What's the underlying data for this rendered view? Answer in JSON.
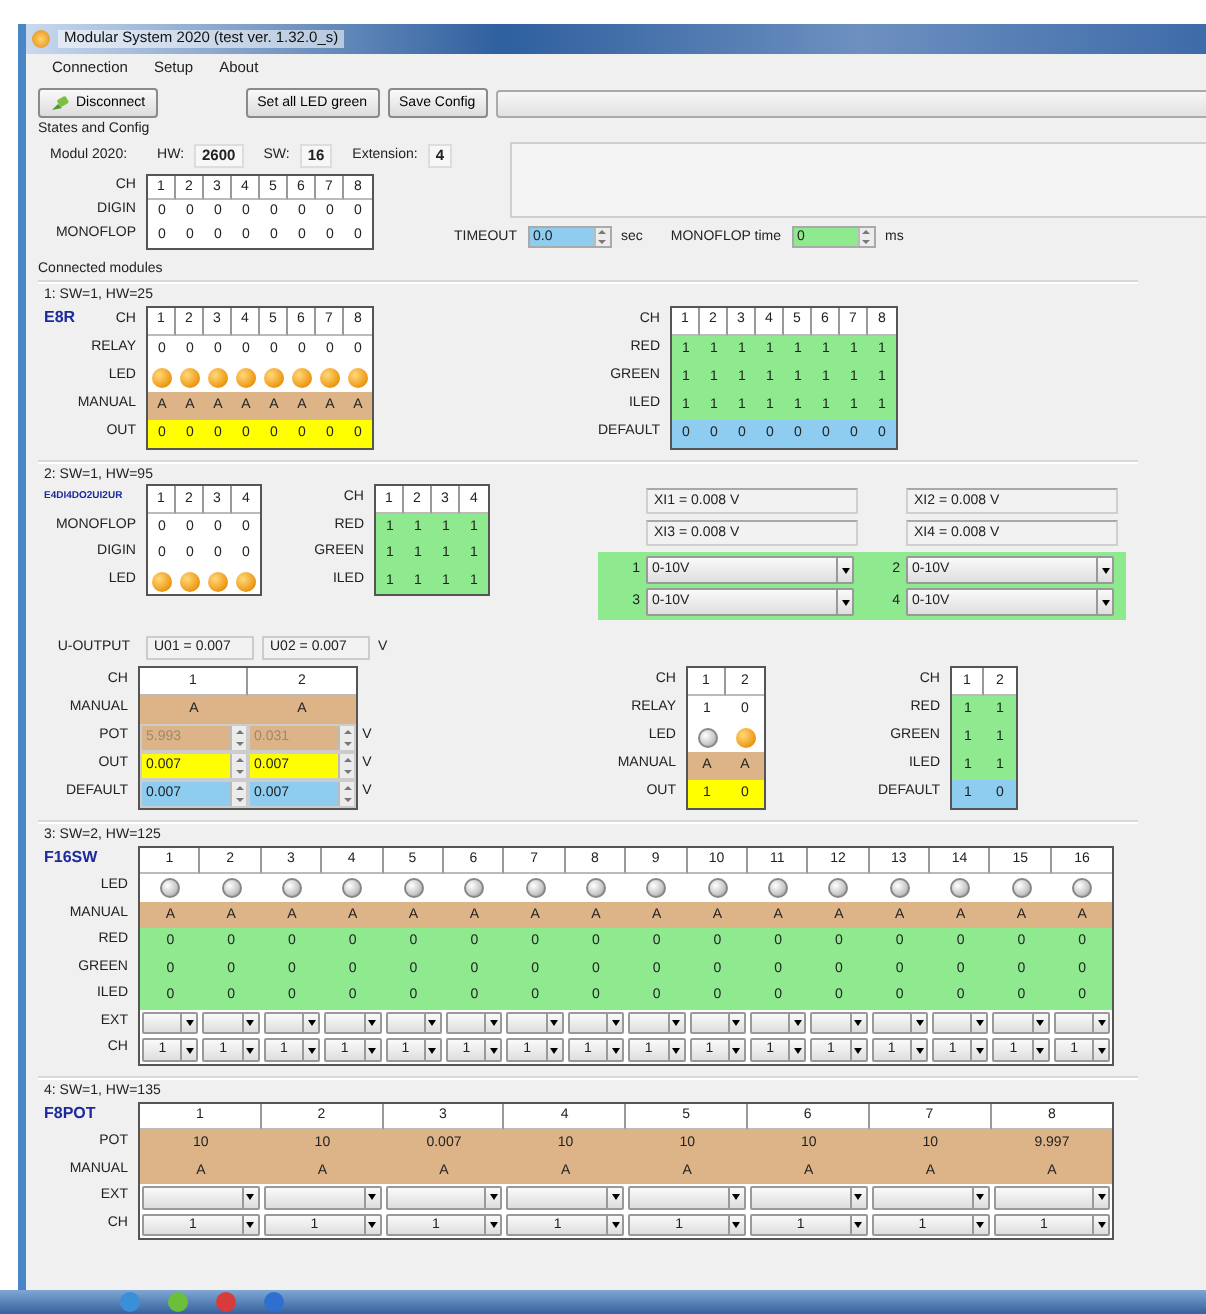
{
  "window": {
    "title": "Modular System 2020 (test ver. 1.32.0_s)"
  },
  "menu": [
    "Connection",
    "Setup",
    "About"
  ],
  "toolbar": {
    "buttons": [
      {
        "label": "Disconnect",
        "kind": "icon"
      },
      {
        "label": "Set all LED green",
        "kind": "plain"
      },
      {
        "label": "Save Config",
        "kind": "plain"
      }
    ]
  },
  "states": {
    "title": "States and Config",
    "module_label": "Modul 2020:",
    "fields": [
      {
        "label": "HW:",
        "value": "2600"
      },
      {
        "label": "SW:",
        "value": "16"
      },
      {
        "label": "Extension:",
        "value": "4"
      }
    ],
    "grid": {
      "corner": "CH",
      "header": [
        "1",
        "2",
        "3",
        "4",
        "5",
        "6",
        "7",
        "8"
      ],
      "rows": [
        {
          "label": "DIGIN",
          "kind": "text",
          "cells": [
            "0",
            "0",
            "0",
            "0",
            "0",
            "0",
            "0",
            "0"
          ]
        },
        {
          "label": "MONOFLOP",
          "kind": "text",
          "cells": [
            "0",
            "0",
            "0",
            "0",
            "0",
            "0",
            "0",
            "0"
          ]
        }
      ]
    },
    "timeout": {
      "label": "TIMEOUT",
      "value": "0.0",
      "unit": "sec"
    },
    "monoflop_time": {
      "label": "MONOFLOP time",
      "value": "0",
      "unit": "ms"
    }
  },
  "connected_modules": {
    "title": "Connected modules",
    "modules": [
      {
        "heading": "1: SW=1, HW=25",
        "name": "E8R",
        "lines": [
          [
            {
              "kind": "grid",
              "corner": "CH",
              "header": [
                "1",
                "2",
                "3",
                "4",
                "5",
                "6",
                "7",
                "8"
              ],
              "rows": [
                {
                  "label": "RELAY",
                  "kind": "text",
                  "cells": [
                    "0",
                    "0",
                    "0",
                    "0",
                    "0",
                    "0",
                    "0",
                    "0"
                  ]
                },
                {
                  "label": "LED",
                  "kind": "led",
                  "cells": [
                    {
                      "on": true
                    },
                    {
                      "on": true
                    },
                    {
                      "on": true
                    },
                    {
                      "on": true
                    },
                    {
                      "on": true
                    },
                    {
                      "on": true
                    },
                    {
                      "on": true
                    },
                    {
                      "on": true
                    }
                  ]
                },
                {
                  "label": "MANUAL",
                  "kind": "text",
                  "color": "#ddb487",
                  "cells": [
                    "A",
                    "A",
                    "A",
                    "A",
                    "A",
                    "A",
                    "A",
                    "A"
                  ]
                },
                {
                  "label": "OUT",
                  "kind": "text",
                  "color": "#ffff00",
                  "cells": [
                    "0",
                    "0",
                    "0",
                    "0",
                    "0",
                    "0",
                    "0",
                    "0"
                  ]
                }
              ]
            },
            {
              "kind": "grid",
              "corner": "CH",
              "header": [
                "1",
                "2",
                "3",
                "4",
                "5",
                "6",
                "7",
                "8"
              ],
              "rows": [
                {
                  "label": "RED",
                  "kind": "text",
                  "color": "#8fe98f",
                  "cells": [
                    "1",
                    "1",
                    "1",
                    "1",
                    "1",
                    "1",
                    "1",
                    "1"
                  ]
                },
                {
                  "label": "GREEN",
                  "kind": "text",
                  "color": "#8fe98f",
                  "cells": [
                    "1",
                    "1",
                    "1",
                    "1",
                    "1",
                    "1",
                    "1",
                    "1"
                  ]
                },
                {
                  "label": "ILED",
                  "kind": "text",
                  "color": "#8fe98f",
                  "cells": [
                    "1",
                    "1",
                    "1",
                    "1",
                    "1",
                    "1",
                    "1",
                    "1"
                  ]
                },
                {
                  "label": "DEFAULT",
                  "kind": "text",
                  "color": "#8fcdf0",
                  "cells": [
                    "0",
                    "0",
                    "0",
                    "0",
                    "0",
                    "0",
                    "0",
                    "0"
                  ]
                }
              ]
            }
          ]
        ]
      },
      {
        "heading": "2: SW=1, HW=95",
        "name": "E4DI4DO2UI2UR",
        "lines": [
          [
            {
              "kind": "grid",
              "header": [
                "1",
                "2",
                "3",
                "4"
              ],
              "rows": [
                {
                  "label": "MONOFLOP",
                  "kind": "text",
                  "cells": [
                    "0",
                    "0",
                    "0",
                    "0"
                  ]
                },
                {
                  "label": "DIGIN",
                  "kind": "text",
                  "cells": [
                    "0",
                    "0",
                    "0",
                    "0"
                  ]
                },
                {
                  "label": "LED",
                  "kind": "led",
                  "cells": [
                    {
                      "on": true
                    },
                    {
                      "on": true
                    },
                    {
                      "on": true
                    },
                    {
                      "on": true
                    }
                  ]
                }
              ]
            },
            {
              "kind": "grid",
              "corner": "CH",
              "header": [
                "1",
                "2",
                "3",
                "4"
              ],
              "rows": [
                {
                  "label": "RED",
                  "kind": "text",
                  "color": "#8fe98f",
                  "cells": [
                    "1",
                    "1",
                    "1",
                    "1"
                  ]
                },
                {
                  "label": "GREEN",
                  "kind": "text",
                  "color": "#8fe98f",
                  "cells": [
                    "1",
                    "1",
                    "1",
                    "1"
                  ]
                },
                {
                  "label": "ILED",
                  "kind": "text",
                  "color": "#8fe98f",
                  "cells": [
                    "1",
                    "1",
                    "1",
                    "1"
                  ]
                }
              ]
            },
            {
              "kind": "inputs",
              "readouts": [
                "XI1 = 0.008 V",
                "XI2 = 0.008 V",
                "XI3 = 0.008 V",
                "XI4 = 0.008 V"
              ],
              "selects": [
                {
                  "channel": "1",
                  "value": "0-10V"
                },
                {
                  "channel": "2",
                  "value": "0-10V"
                },
                {
                  "channel": "3",
                  "value": "0-10V"
                },
                {
                  "channel": "4",
                  "value": "0-10V"
                }
              ]
            }
          ],
          [
            {
              "kind": "uoutput",
              "label": "U-OUTPUT",
              "values": [
                "U01 = 0.007",
                "U02 = 0.007"
              ],
              "unit": "V"
            }
          ],
          [
            {
              "kind": "grid",
              "corner": "CH",
              "header": [
                "1",
                "2"
              ],
              "rows": [
                {
                  "label": "MANUAL",
                  "kind": "text",
                  "color": "#ddb487",
                  "cells": [
                    "A",
                    "A"
                  ]
                },
                {
                  "label": "POT",
                  "kind": "spin",
                  "color": "#ddb487",
                  "disabled": true,
                  "unit": "V",
                  "cells": [
                    {
                      "value": "5.993"
                    },
                    {
                      "value": "0.031"
                    }
                  ]
                },
                {
                  "label": "OUT",
                  "kind": "spin",
                  "color": "#ffff00",
                  "disabled": false,
                  "unit": "V",
                  "cells": [
                    {
                      "value": "0.007"
                    },
                    {
                      "value": "0.007"
                    }
                  ]
                },
                {
                  "label": "DEFAULT",
                  "kind": "spin",
                  "color": "#8fcdf0",
                  "disabled": false,
                  "unit": "V",
                  "cells": [
                    {
                      "value": "0.007"
                    },
                    {
                      "value": "0.007"
                    }
                  ]
                }
              ]
            },
            {
              "kind": "grid",
              "corner": "CH",
              "header": [
                "1",
                "2"
              ],
              "rows": [
                {
                  "label": "RELAY",
                  "kind": "text",
                  "cells": [
                    "1",
                    "0"
                  ]
                },
                {
                  "label": "LED",
                  "kind": "led",
                  "cells": [
                    {
                      "on": false
                    },
                    {
                      "on": true
                    }
                  ]
                },
                {
                  "label": "MANUAL",
                  "kind": "text",
                  "color": "#ddb487",
                  "cells": [
                    "A",
                    "A"
                  ]
                },
                {
                  "label": "OUT",
                  "kind": "text",
                  "color": "#ffff00",
                  "cells": [
                    "1",
                    "0"
                  ]
                }
              ]
            },
            {
              "kind": "grid",
              "corner": "CH",
              "header": [
                "1",
                "2"
              ],
              "rows": [
                {
                  "label": "RED",
                  "kind": "text",
                  "color": "#8fe98f",
                  "cells": [
                    "1",
                    "1"
                  ]
                },
                {
                  "label": "GREEN",
                  "kind": "text",
                  "color": "#8fe98f",
                  "cells": [
                    "1",
                    "1"
                  ]
                },
                {
                  "label": "ILED",
                  "kind": "text",
                  "color": "#8fe98f",
                  "cells": [
                    "1",
                    "1"
                  ]
                },
                {
                  "label": "DEFAULT",
                  "kind": "text",
                  "color": "#8fcdf0",
                  "cells": [
                    "1",
                    "0"
                  ]
                }
              ]
            }
          ]
        ]
      },
      {
        "heading": "3: SW=2, HW=125",
        "name": "F16SW",
        "lines": [
          [
            {
              "kind": "grid",
              "header": [
                "1",
                "2",
                "3",
                "4",
                "5",
                "6",
                "7",
                "8",
                "9",
                "10",
                "11",
                "12",
                "13",
                "14",
                "15",
                "16"
              ],
              "rows": [
                {
                  "label": "LED",
                  "kind": "led",
                  "cells": [
                    {
                      "on": false
                    },
                    {
                      "on": false
                    },
                    {
                      "on": false
                    },
                    {
                      "on": false
                    },
                    {
                      "on": false
                    },
                    {
                      "on": false
                    },
                    {
                      "on": false
                    },
                    {
                      "on": false
                    },
                    {
                      "on": false
                    },
                    {
                      "on": false
                    },
                    {
                      "on": false
                    },
                    {
                      "on": false
                    },
                    {
                      "on": false
                    },
                    {
                      "on": false
                    },
                    {
                      "on": false
                    },
                    {
                      "on": false
                    }
                  ]
                },
                {
                  "label": "MANUAL",
                  "kind": "text",
                  "color": "#ddb487",
                  "cells": [
                    "A",
                    "A",
                    "A",
                    "A",
                    "A",
                    "A",
                    "A",
                    "A",
                    "A",
                    "A",
                    "A",
                    "A",
                    "A",
                    "A",
                    "A",
                    "A"
                  ]
                },
                {
                  "label": "RED",
                  "kind": "text",
                  "color": "#8fe98f",
                  "cells": [
                    "0",
                    "0",
                    "0",
                    "0",
                    "0",
                    "0",
                    "0",
                    "0",
                    "0",
                    "0",
                    "0",
                    "0",
                    "0",
                    "0",
                    "0",
                    "0"
                  ]
                },
                {
                  "label": "GREEN",
                  "kind": "text",
                  "color": "#8fe98f",
                  "cells": [
                    "0",
                    "0",
                    "0",
                    "0",
                    "0",
                    "0",
                    "0",
                    "0",
                    "0",
                    "0",
                    "0",
                    "0",
                    "0",
                    "0",
                    "0",
                    "0"
                  ]
                },
                {
                  "label": "ILED",
                  "kind": "text",
                  "color": "#8fe98f",
                  "cells": [
                    "0",
                    "0",
                    "0",
                    "0",
                    "0",
                    "0",
                    "0",
                    "0",
                    "0",
                    "0",
                    "0",
                    "0",
                    "0",
                    "0",
                    "0",
                    "0"
                  ]
                },
                {
                  "label": "EXT",
                  "kind": "combo",
                  "cells": [
                    {},
                    {},
                    {},
                    {},
                    {},
                    {},
                    {},
                    {},
                    {},
                    {},
                    {},
                    {},
                    {},
                    {},
                    {},
                    {}
                  ]
                },
                {
                  "label": "CH",
                  "kind": "combo",
                  "cells": [
                    {
                      "value": "1"
                    },
                    {
                      "value": "1"
                    },
                    {
                      "value": "1"
                    },
                    {
                      "value": "1"
                    },
                    {
                      "value": "1"
                    },
                    {
                      "value": "1"
                    },
                    {
                      "value": "1"
                    },
                    {
                      "value": "1"
                    },
                    {
                      "value": "1"
                    },
                    {
                      "value": "1"
                    },
                    {
                      "value": "1"
                    },
                    {
                      "value": "1"
                    },
                    {
                      "value": "1"
                    },
                    {
                      "value": "1"
                    },
                    {
                      "value": "1"
                    },
                    {
                      "value": "1"
                    }
                  ]
                }
              ]
            }
          ]
        ]
      },
      {
        "heading": "4: SW=1, HW=135",
        "name": "F8POT",
        "lines": [
          [
            {
              "kind": "grid",
              "header": [
                "1",
                "2",
                "3",
                "4",
                "5",
                "6",
                "7",
                "8"
              ],
              "rows": [
                {
                  "label": "POT",
                  "kind": "text",
                  "color": "#ddb487",
                  "cells": [
                    "10",
                    "10",
                    "0.007",
                    "10",
                    "10",
                    "10",
                    "10",
                    "9.997"
                  ]
                },
                {
                  "label": "MANUAL",
                  "kind": "text",
                  "color": "#ddb487",
                  "cells": [
                    "A",
                    "A",
                    "A",
                    "A",
                    "A",
                    "A",
                    "A",
                    "A"
                  ]
                },
                {
                  "label": "EXT",
                  "kind": "combo",
                  "cells": [
                    {},
                    {},
                    {},
                    {},
                    {},
                    {},
                    {},
                    {}
                  ]
                },
                {
                  "label": "CH",
                  "kind": "combo",
                  "cells": [
                    {
                      "value": "1"
                    },
                    {
                      "value": "1"
                    },
                    {
                      "value": "1"
                    },
                    {
                      "value": "1"
                    },
                    {
                      "value": "1"
                    },
                    {
                      "value": "1"
                    },
                    {
                      "value": "1"
                    },
                    {
                      "value": "1"
                    }
                  ]
                }
              ]
            }
          ]
        ]
      }
    ]
  }
}
